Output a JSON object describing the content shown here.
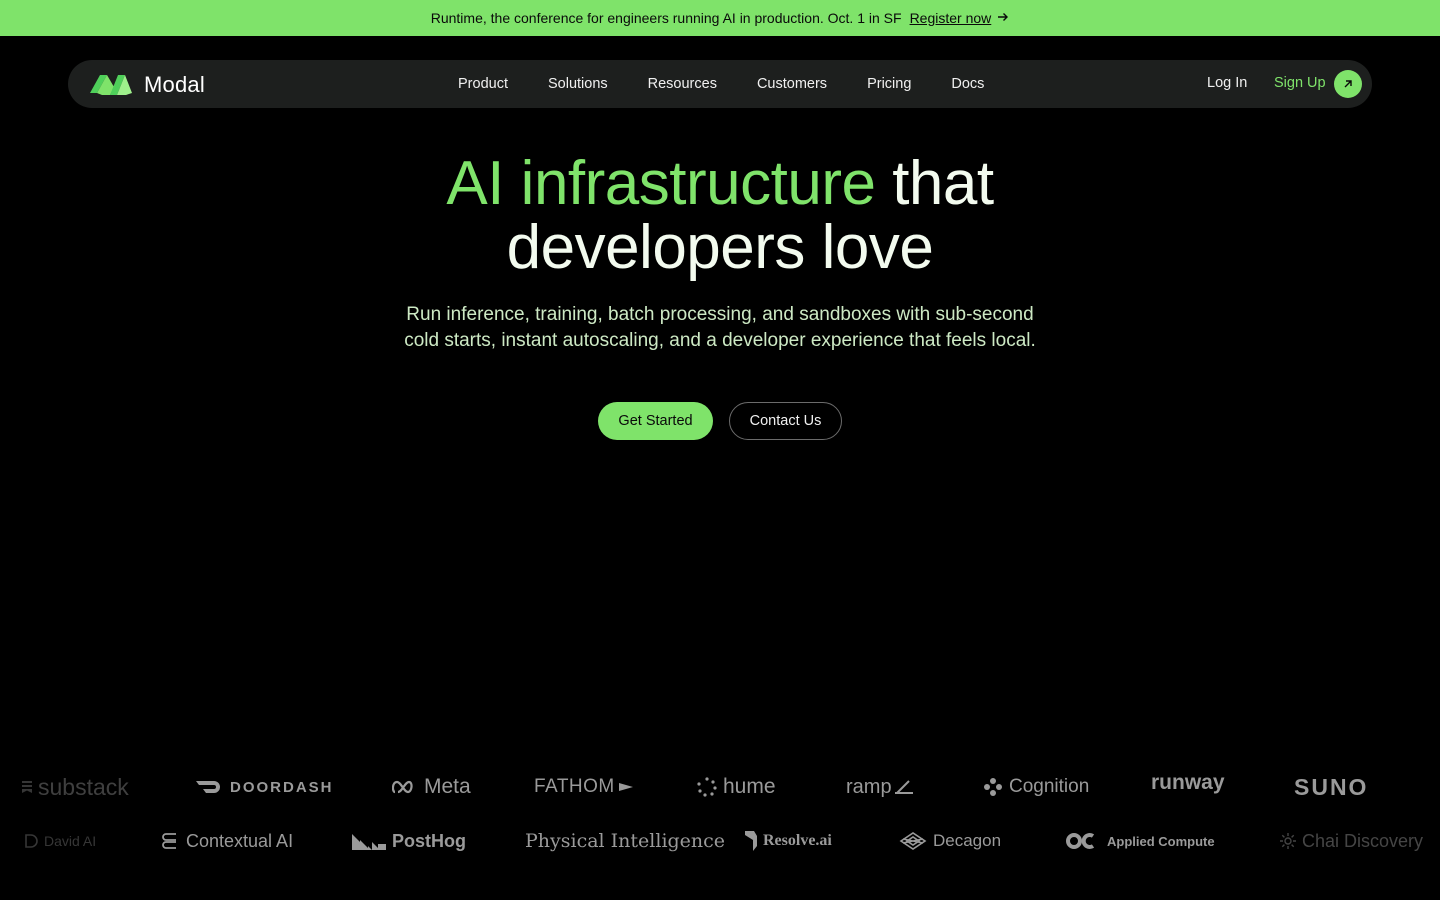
{
  "announcement": {
    "text": "Runtime, the conference for engineers running AI in production. Oct. 1 in SF",
    "link": "Register now"
  },
  "nav": {
    "brand": "Modal",
    "links": [
      "Product",
      "Solutions",
      "Resources",
      "Customers",
      "Pricing",
      "Docs"
    ],
    "login": "Log In",
    "signup": "Sign Up"
  },
  "hero": {
    "title_highlight": "AI infrastructure",
    "title_rest_line1": "that",
    "title_line2": "developers love",
    "subtitle": "Run inference, training, batch processing, and sandboxes with sub-second cold starts, instant autoscaling, and a developer experience that feels local.",
    "primary_cta": "Get Started",
    "secondary_cta": "Contact Us"
  },
  "customers": {
    "row1": [
      "substack",
      "DOORDASH",
      "Meta",
      "FATHOM",
      "hume",
      "ramp",
      "Cognition",
      "runway",
      "SUNO"
    ],
    "row2": [
      "David AI",
      "Contextual AI",
      "PostHog",
      "Physical Intelligence",
      "Resolve.ai",
      "Decagon",
      "Applied Compute",
      "Chai Discovery"
    ]
  },
  "colors": {
    "accent": "#7fe36a",
    "background": "#000000",
    "nav_bg": "#1d1f1e",
    "logo_gray": "#9a9a9a"
  }
}
